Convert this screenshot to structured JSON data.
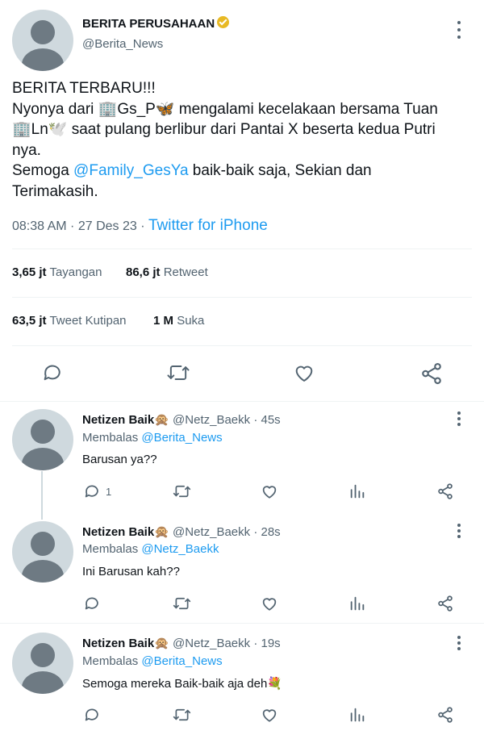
{
  "main_tweet": {
    "author_name": "BERITA PERUSAHAAN",
    "handle": "@Berita_News",
    "text_line1": "BERITA TERBARU!!!",
    "text_line2_a": "Nyonya dari 🏢Gs_P🦋 mengalami kecelakaan bersama Tuan",
    "text_line2_b": "🏢Ln🕊️ saat pulang berlibur dari Pantai X beserta kedua Putri",
    "text_line2_c": "nya.",
    "text_line3_prefix": "Semoga ",
    "text_mention": "@Family_GesYa",
    "text_line3_suffix": " baik-baik saja, Sekian dan",
    "text_line4": "Terimakasih.",
    "time": "08:38 AM · 27 Des 23 · ",
    "source": "Twitter for iPhone",
    "stats": {
      "views_value": "3,65 jt",
      "views_label": "Tayangan",
      "retweets_value": "86,6 jt",
      "retweets_label": "Retweet",
      "quotes_value": "63,5 jt",
      "quotes_label": "Tweet Kutipan",
      "likes_value": "1 M",
      "likes_label": "Suka"
    }
  },
  "replies": [
    {
      "name": "Netizen Baik🙊",
      "handle": "@Netz_Baekk",
      "time": "· 45s",
      "replying_label": "Membalas ",
      "replying_to": "@Berita_News",
      "text": "Barusan ya??",
      "reply_count": "1"
    },
    {
      "name": "Netizen Baik🙊",
      "handle": "@Netz_Baekk",
      "time": "· 28s",
      "replying_label": "Membalas ",
      "replying_to": "@Netz_Baekk",
      "text": "Ini Barusan kah??",
      "reply_count": ""
    },
    {
      "name": "Netizen Baik🙊",
      "handle": "@Netz_Baekk",
      "time": "· 19s",
      "replying_label": "Membalas ",
      "replying_to": "@Berita_News",
      "text": "Semoga mereka Baik-baik aja deh💐",
      "reply_count": ""
    }
  ],
  "colors": {
    "accent": "#1d9bf0",
    "verified_badge": "#e8b923",
    "secondary_text": "#536471",
    "avatar_bg": "#cfd9de",
    "avatar_fg": "#6e7a83"
  }
}
